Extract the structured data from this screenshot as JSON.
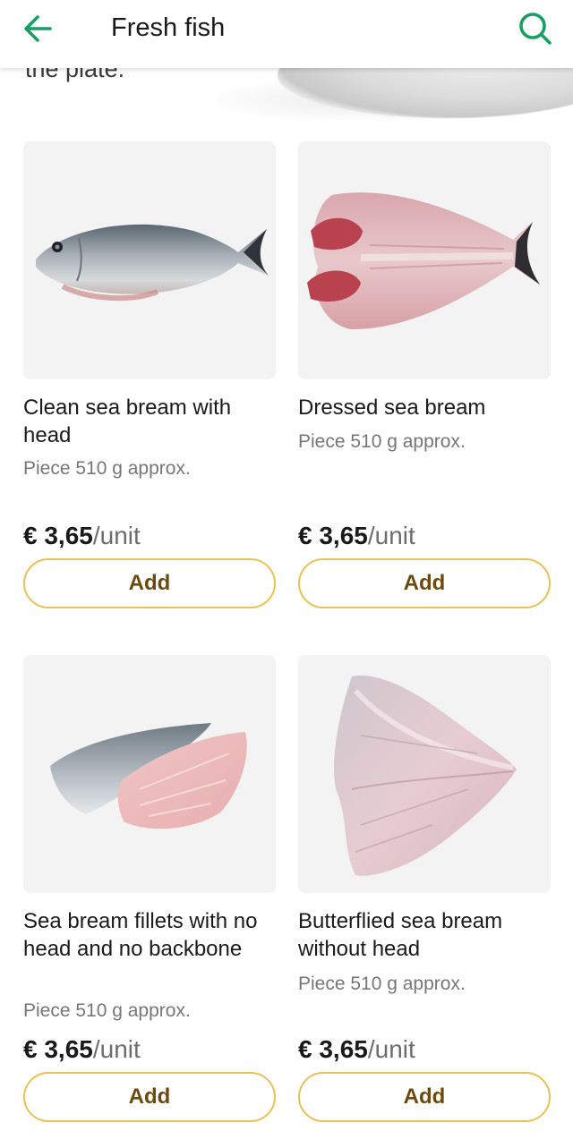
{
  "colors": {
    "accent_green": "#18a064",
    "button_border": "#e8c255",
    "button_text": "#6b4a10",
    "secondary_text": "#767676"
  },
  "header": {
    "title": "Fresh fish",
    "back_icon": "arrow-left-icon",
    "search_icon": "search-icon"
  },
  "banner": {
    "partial_text": "the plate."
  },
  "products": [
    {
      "name": "Clean sea bream with head",
      "weight": "Piece 510 g approx.",
      "price": "€ 3,65",
      "unit": "/unit",
      "add_label": "Add",
      "image": "whole-sea-bream-image"
    },
    {
      "name": "Dressed sea bream",
      "weight": "Piece 510 g approx.",
      "price": "€ 3,65",
      "unit": "/unit",
      "add_label": "Add",
      "image": "dressed-sea-bream-image"
    },
    {
      "name": "Sea bream fillets with no head and no backbone",
      "weight": "Piece 510 g approx.",
      "price": "€ 3,65",
      "unit": "/unit",
      "add_label": "Add",
      "image": "sea-bream-fillets-image"
    },
    {
      "name": "Butterflied sea bream without head",
      "weight": "Piece 510 g approx.",
      "price": "€ 3,65",
      "unit": "/unit",
      "add_label": "Add",
      "image": "butterflied-sea-bream-image"
    }
  ]
}
